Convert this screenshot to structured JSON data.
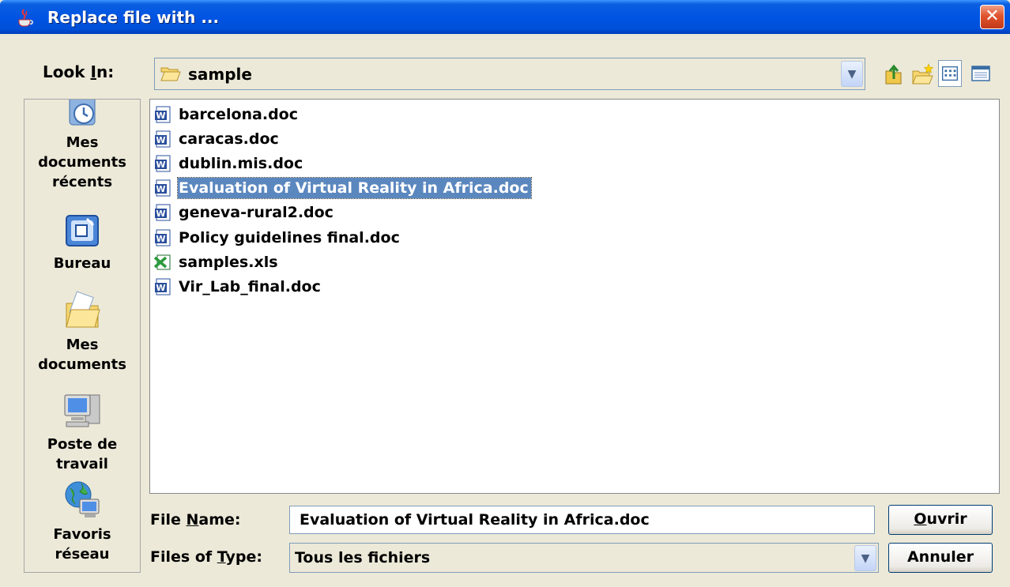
{
  "window": {
    "title": "Replace file with ..."
  },
  "toolbar": {
    "lookin_label": "Look In:",
    "lookin_label_prefix": "Look ",
    "lookin_label_key": "I",
    "lookin_label_suffix": "n:",
    "current_folder": "sample",
    "icons": [
      "up-folder-icon",
      "new-folder-icon",
      "list-view-icon",
      "details-view-icon"
    ]
  },
  "places": [
    {
      "label_lines": [
        "Mes",
        "documents",
        "récents"
      ],
      "icon": "recent-documents-icon"
    },
    {
      "label_lines": [
        "Bureau"
      ],
      "icon": "desktop-icon"
    },
    {
      "label_lines": [
        "Mes",
        "documents"
      ],
      "icon": "my-documents-icon"
    },
    {
      "label_lines": [
        "Poste de",
        "travail"
      ],
      "icon": "my-computer-icon"
    },
    {
      "label_lines": [
        "Favoris",
        "réseau"
      ],
      "icon": "network-places-icon"
    }
  ],
  "files": [
    {
      "name": "barcelona.doc",
      "type": "word"
    },
    {
      "name": "caracas.doc",
      "type": "word"
    },
    {
      "name": "dublin.mis.doc",
      "type": "word"
    },
    {
      "name": "Evaluation of Virtual Reality in Africa.doc",
      "type": "word",
      "selected": true
    },
    {
      "name": "geneva-rural2.doc",
      "type": "word"
    },
    {
      "name": "Policy guidelines final.doc",
      "type": "word"
    },
    {
      "name": "samples.xls",
      "type": "excel"
    },
    {
      "name": "Vir_Lab_final.doc",
      "type": "word"
    }
  ],
  "form": {
    "filename_label_prefix": "File ",
    "filename_label_key": "N",
    "filename_label_suffix": "ame:",
    "filename_value": "Evaluation of Virtual Reality in Africa.doc",
    "filetype_label_prefix": "Files of ",
    "filetype_label_key": "T",
    "filetype_label_suffix": "ype:",
    "filetype_value": "Tous les fichiers"
  },
  "buttons": {
    "open_key": "O",
    "open_rest": "uvrir",
    "cancel": "Annuler"
  },
  "colors": {
    "title_bar": "#0054e3",
    "selection": "#5b87bf",
    "window_bg": "#ece9d8"
  }
}
